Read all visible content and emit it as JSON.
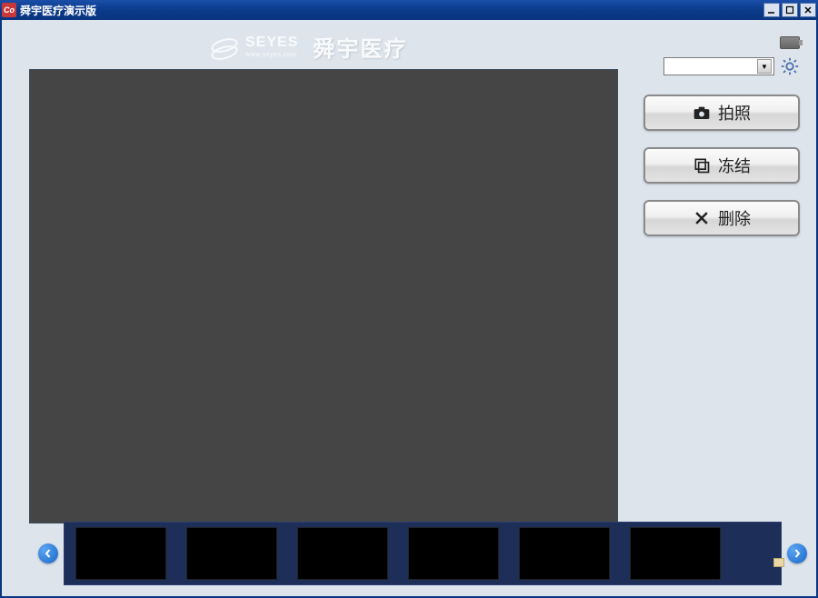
{
  "window": {
    "app_icon_text": "Co",
    "title": "舜宇医疗演示版"
  },
  "logo": {
    "english": "SEYES",
    "url": "www.seyes.com",
    "chinese": "舜宇医疗"
  },
  "device_dropdown": {
    "value": ""
  },
  "buttons": {
    "capture": "拍照",
    "freeze": "冻结",
    "delete": "删除"
  },
  "thumbnails": {
    "count": 6
  }
}
